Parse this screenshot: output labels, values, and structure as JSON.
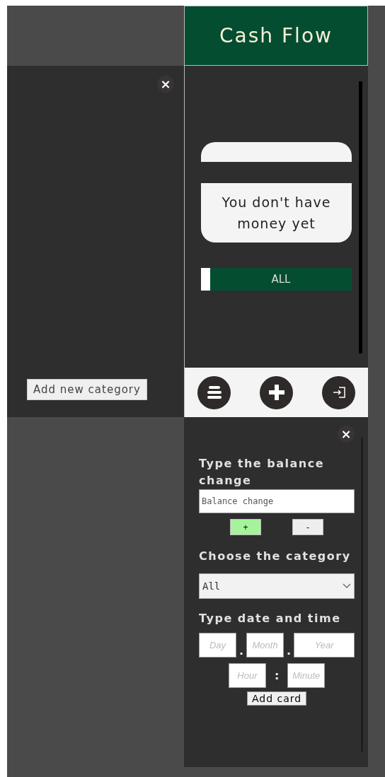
{
  "header": {
    "title": "Cash Flow"
  },
  "categories_panel": {
    "close": "×",
    "add_button": "Add new category"
  },
  "main": {
    "empty_message": "You don't have money yet",
    "categories": [
      {
        "label": "ALL",
        "selected": true
      }
    ]
  },
  "nav": {
    "buttons": [
      {
        "kind": "list"
      },
      {
        "kind": "add"
      },
      {
        "kind": "exit"
      }
    ]
  },
  "form": {
    "close": "×",
    "balance_label": "Type the balance change",
    "balance_placeholder": "Balance change",
    "signs": [
      {
        "label": "+",
        "selected": true
      },
      {
        "label": "-",
        "selected": false
      }
    ],
    "category_label": "Choose the category",
    "category_value": "All",
    "datetime_label": "Type date and time",
    "date_fields": [
      {
        "placeholder": "Day"
      },
      {
        "placeholder": "Month"
      },
      {
        "placeholder": "Year"
      }
    ],
    "date_separators": [
      ".",
      "."
    ],
    "time_fields": [
      {
        "placeholder": "Hour"
      },
      {
        "placeholder": "Minute"
      }
    ],
    "time_separator": ":",
    "submit": "Add card"
  }
}
